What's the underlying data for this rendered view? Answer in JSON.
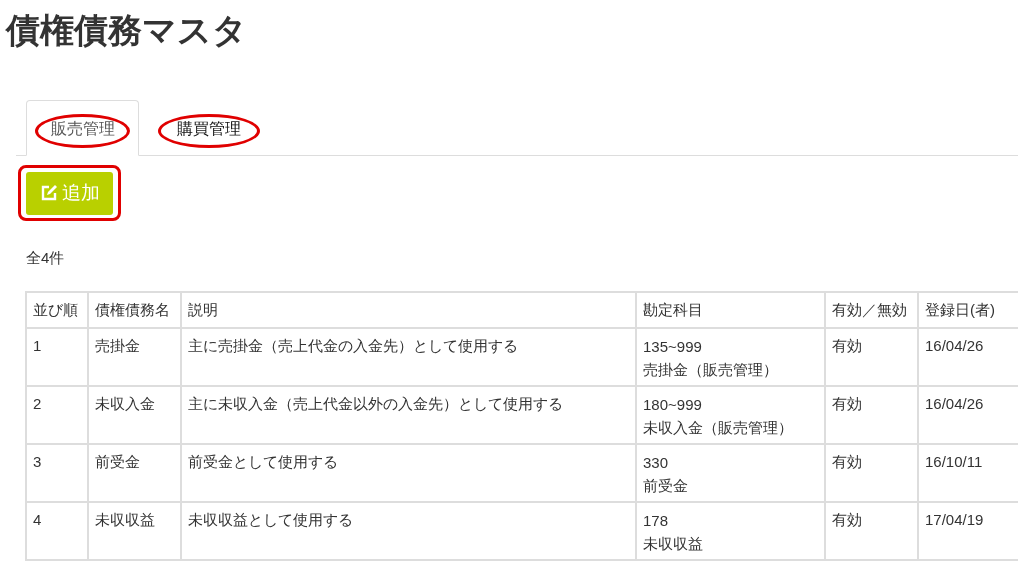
{
  "title": "債権債務マスタ",
  "tabs": [
    {
      "label": "販売管理",
      "selected": true,
      "circled": true
    },
    {
      "label": "購買管理",
      "selected": false,
      "circled": true
    }
  ],
  "add_button": {
    "label": "追加",
    "circled": true
  },
  "count": "全4件",
  "table": {
    "columns": [
      "並び順",
      "債権債務名",
      "説明",
      "勘定科目",
      "有効／無効",
      "登録日(者)"
    ],
    "rows": [
      {
        "order": "1",
        "name": "売掛金",
        "description": "主に売掛金（売上代金の入金先）として使用する",
        "account_code": "135~999",
        "account_name": "売掛金（販売管理）",
        "status": "有効",
        "registered": "16/04/26"
      },
      {
        "order": "2",
        "name": "未収入金",
        "description": "主に未収入金（売上代金以外の入金先）として使用する",
        "account_code": "180~999",
        "account_name": "未収入金（販売管理）",
        "status": "有効",
        "registered": "16/04/26"
      },
      {
        "order": "3",
        "name": "前受金",
        "description": "前受金として使用する",
        "account_code": "330",
        "account_name": "前受金",
        "status": "有効",
        "registered": "16/10/11"
      },
      {
        "order": "4",
        "name": "未収収益",
        "description": "未収収益として使用する",
        "account_code": "178",
        "account_name": "未収収益",
        "status": "有効",
        "registered": "17/04/19"
      }
    ]
  }
}
